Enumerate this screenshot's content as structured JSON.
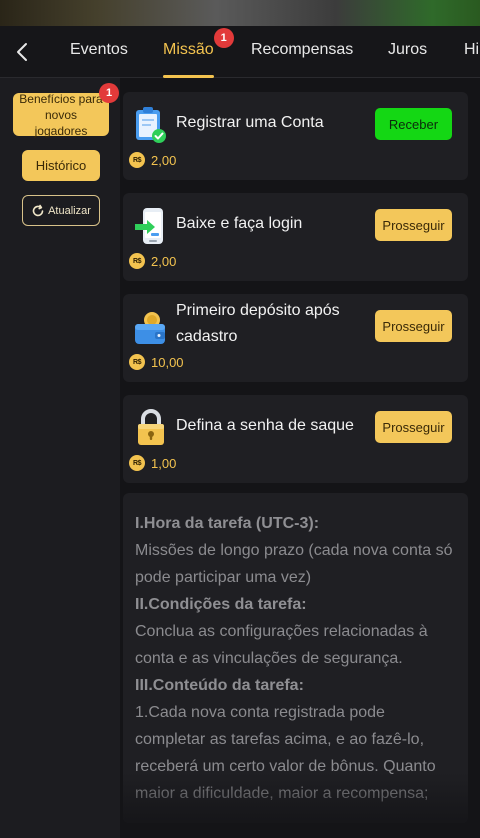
{
  "tabs": [
    {
      "label": "Eventos",
      "active": false
    },
    {
      "label": "Missão",
      "active": true,
      "badge": "1"
    },
    {
      "label": "Recompensas",
      "active": false
    },
    {
      "label": "Juros",
      "active": false
    },
    {
      "label": "Hi",
      "active": false
    }
  ],
  "sidebar": {
    "new_players_label": "Benefícios para novos jogadores",
    "new_players_badge": "1",
    "history_label": "Histórico",
    "refresh_label": "Atualizar"
  },
  "currency_symbol": "R$",
  "tasks": [
    {
      "title": "Registrar uma Conta",
      "reward": "2,00",
      "button": "Receber",
      "button_style": "green",
      "icon": "clipboard-check-icon"
    },
    {
      "title": "Baixe e faça login",
      "reward": "2,00",
      "button": "Prosseguir",
      "button_style": "gold",
      "icon": "phone-download-icon"
    },
    {
      "title": "Primeiro depósito após cadastro",
      "reward": "10,00",
      "button": "Prosseguir",
      "button_style": "gold",
      "icon": "wallet-coin-icon"
    },
    {
      "title": "Defina a senha de saque",
      "reward": "1,00",
      "button": "Prosseguir",
      "button_style": "gold",
      "icon": "padlock-icon"
    }
  ],
  "info": {
    "h1": "I.Hora da tarefa (UTC-3):",
    "p1": "Missões de longo prazo (cada nova conta só pode participar uma vez)",
    "h2": "II.Condições da tarefa:",
    "p2": "Conclua as configurações relacionadas à conta e as vinculações de segurança.",
    "h3": "III.Conteúdo da tarefa:",
    "p3": "1.Cada nova conta registrada pode completar as tarefas acima, e ao fazê-lo, receberá um certo valor de bônus. Quanto maior a dificuldade, maior a recompensa;"
  },
  "colors": {
    "accent": "#f3c34f",
    "success": "#14d714",
    "badge": "#e23a3a",
    "background": "#1c1c20"
  }
}
